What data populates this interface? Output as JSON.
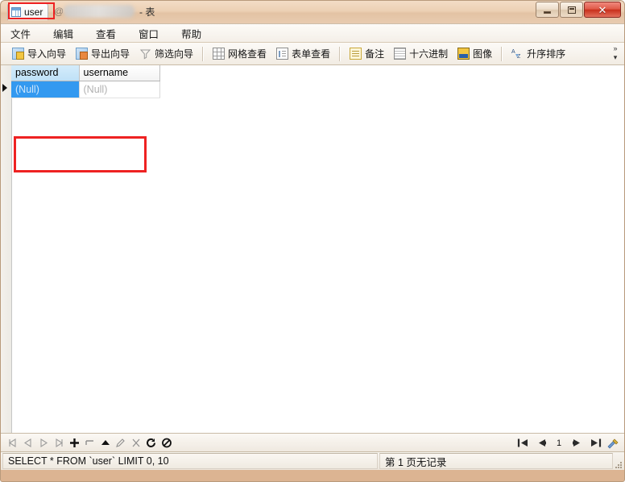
{
  "window": {
    "tab_label": "user",
    "title_at": "@",
    "title_suffix": "- 表",
    "minimize_label": "最小化",
    "maximize_label": "最大化",
    "close_label": "✕"
  },
  "menubar": {
    "items": [
      {
        "label": "文件",
        "name": "menu-file"
      },
      {
        "label": "编辑",
        "name": "menu-edit"
      },
      {
        "label": "查看",
        "name": "menu-view"
      },
      {
        "label": "窗口",
        "name": "menu-window"
      },
      {
        "label": "帮助",
        "name": "menu-help"
      }
    ]
  },
  "toolbar": {
    "import_wizard": "导入向导",
    "export_wizard": "导出向导",
    "filter_wizard": "筛选向导",
    "grid_view": "网格查看",
    "form_view": "表单查看",
    "memo": "备注",
    "hex": "十六进制",
    "image": "图像",
    "sort_asc": "升序排序",
    "overflow": "»"
  },
  "grid": {
    "columns": [
      {
        "key": "password",
        "label": "password",
        "active": true
      },
      {
        "key": "username",
        "label": "username",
        "active": false
      }
    ],
    "rows": [
      {
        "password": "(Null)",
        "username": "(Null)",
        "selected_cell": "password"
      }
    ]
  },
  "navbar": {
    "record_buttons": [
      {
        "name": "nav-first-record",
        "glyph": "⏮"
      },
      {
        "name": "nav-prev-record",
        "glyph": "◁"
      },
      {
        "name": "nav-next-record",
        "glyph": "▷"
      },
      {
        "name": "nav-last-record",
        "glyph": "⏭"
      },
      {
        "name": "nav-add-record",
        "glyph": "✚"
      },
      {
        "name": "nav-delete-record",
        "glyph": "⊐"
      },
      {
        "name": "nav-apply-change",
        "glyph": "▲"
      },
      {
        "name": "nav-edit-record",
        "glyph": "✎"
      },
      {
        "name": "nav-cut-record",
        "glyph": "✂"
      },
      {
        "name": "nav-refresh",
        "glyph": "↻"
      },
      {
        "name": "nav-stop",
        "glyph": "⦸"
      }
    ],
    "page_number": "1",
    "first_page_label": "首页",
    "prev_page_label": "上一页",
    "next_page_label": "下一页",
    "last_page_label": "末页",
    "tools_label": "工具"
  },
  "statusbar": {
    "sql": "SELECT * FROM `user` LIMIT 0, 10",
    "page_info": "第 1 页无记录"
  },
  "colors": {
    "selection_blue": "#3399f0",
    "active_header_blue": "#bfe1f7",
    "annotation_red": "#ee2222",
    "window_frame": "#e4c0a0"
  }
}
